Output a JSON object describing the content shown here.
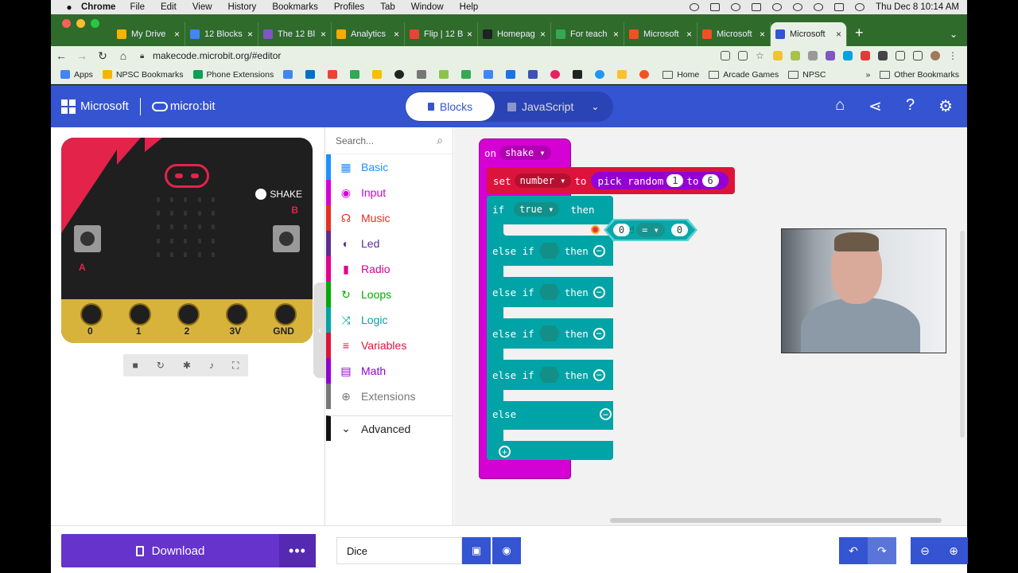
{
  "menubar": {
    "app": "Chrome",
    "items": [
      "File",
      "Edit",
      "View",
      "History",
      "Bookmarks",
      "Profiles",
      "Tab",
      "Window",
      "Help"
    ],
    "clock": "Thu Dec 8  10:14 AM"
  },
  "tabs": [
    {
      "title": "My Drive",
      "color": "#f4b400"
    },
    {
      "title": "12 Blocks",
      "color": "#4285f4"
    },
    {
      "title": "The 12 Bl",
      "color": "#7e57c2"
    },
    {
      "title": "Analytics",
      "color": "#f9ab00"
    },
    {
      "title": "Flip | 12 B",
      "color": "#ea4335"
    },
    {
      "title": "Homepag",
      "color": "#202124"
    },
    {
      "title": "For teach",
      "color": "#34a853"
    },
    {
      "title": "Microsoft",
      "color": "#f25022"
    },
    {
      "title": "Microsoft",
      "color": "#f25022"
    },
    {
      "title": "Microsoft",
      "color": "#3454d1",
      "active": true
    }
  ],
  "url": "makecode.microbit.org/#editor",
  "bookmarks": [
    "Apps",
    "NPSC Bookmarks",
    "Phone Extensions",
    "Home",
    "Arcade Games",
    "NPSC",
    "Other Bookmarks"
  ],
  "header": {
    "brand": "Microsoft",
    "product": "micro:bit",
    "blocks_label": "Blocks",
    "js_label": "JavaScript"
  },
  "simulator": {
    "shake_label": "SHAKE",
    "button_a": "A",
    "button_b": "B",
    "pins": [
      "0",
      "1",
      "2",
      "3V",
      "GND"
    ]
  },
  "toolbox": {
    "search_placeholder": "Search...",
    "categories": [
      {
        "label": "Basic",
        "color": "#1e90ff",
        "icon": "grid-icon"
      },
      {
        "label": "Input",
        "color": "#d400d4",
        "icon": "target-icon"
      },
      {
        "label": "Music",
        "color": "#e63022",
        "icon": "headphones-icon"
      },
      {
        "label": "Led",
        "color": "#5c2d91",
        "icon": "toggle-icon"
      },
      {
        "label": "Radio",
        "color": "#e3008c",
        "icon": "signal-icon"
      },
      {
        "label": "Loops",
        "color": "#00aa00",
        "icon": "refresh-icon"
      },
      {
        "label": "Logic",
        "color": "#00a4a6",
        "icon": "shuffle-icon"
      },
      {
        "label": "Variables",
        "color": "#dc143c",
        "icon": "list-icon"
      },
      {
        "label": "Math",
        "color": "#9400d3",
        "icon": "calculator-icon"
      },
      {
        "label": "Extensions",
        "color": "#777777",
        "icon": "plus-circle-icon"
      }
    ],
    "advanced_label": "Advanced"
  },
  "blocks": {
    "on_shake_kw": "on",
    "on_shake_event": "shake",
    "set_kw": "set",
    "variable": "number",
    "to_kw": "to",
    "pick_random": "pick random",
    "rand_min": "1",
    "rand_to": "to",
    "rand_max": "6",
    "if_kw": "if",
    "condition": "true",
    "then_kw": "then",
    "else_if_kw": "else if",
    "else_kw": "else",
    "compare_left": "0",
    "compare_op": "=",
    "compare_right": "0"
  },
  "footer": {
    "download_label": "Download",
    "more_label": "•••",
    "project_name": "Dice"
  }
}
